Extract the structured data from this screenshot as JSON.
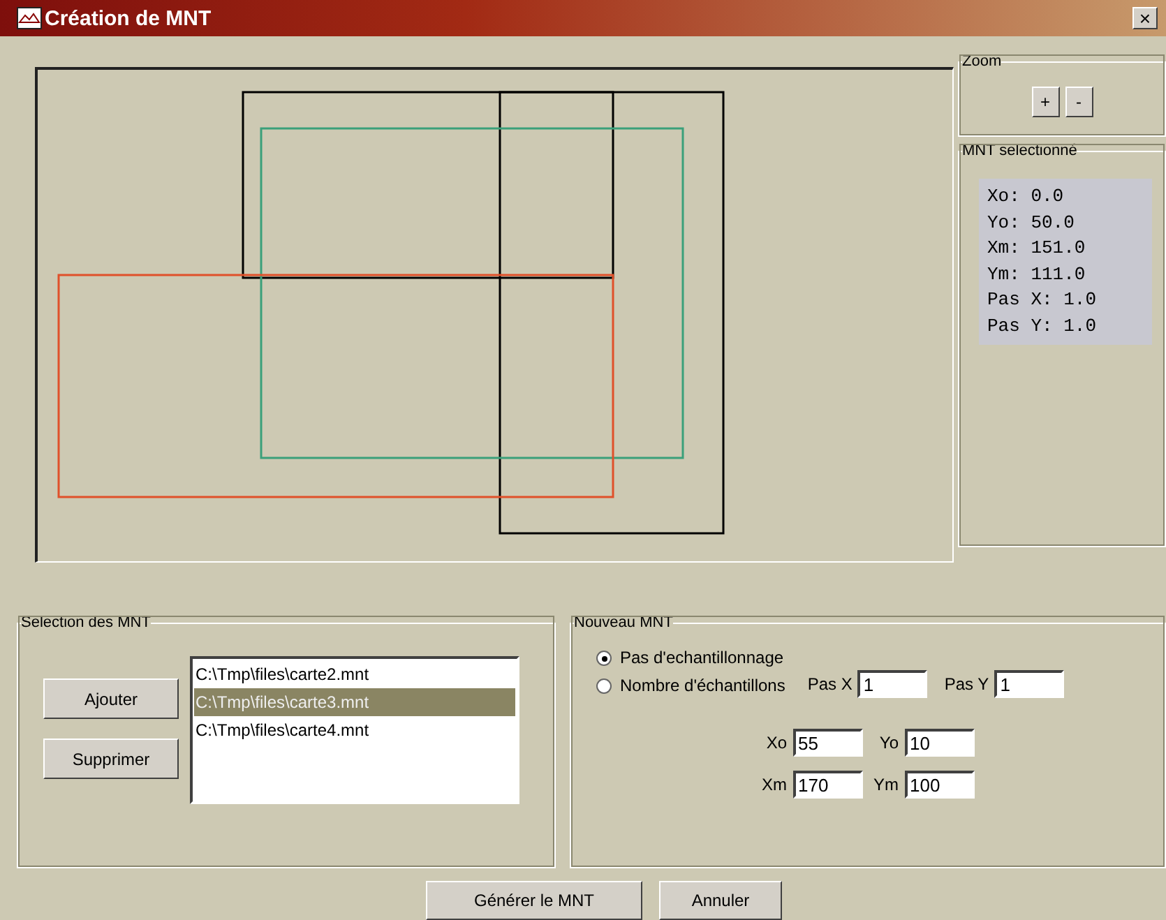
{
  "window": {
    "title": "Création de MNT",
    "close": "×"
  },
  "zoom": {
    "title": "Zoom",
    "buttons": [
      "+",
      "-"
    ]
  },
  "selected_mnt": {
    "title": "MNT selectionné",
    "lines": [
      "Xo: 0.0",
      "Yo: 50.0",
      "Xm: 151.0",
      "Ym: 111.0",
      "Pas X: 1.0",
      "Pas Y: 1.0"
    ]
  },
  "selection": {
    "title": "Selection des MNT",
    "buttons": [
      "Ajouter",
      "Supprimer"
    ],
    "files": [
      {
        "path": "C:\\Tmp\\files\\carte2.mnt",
        "selected": false
      },
      {
        "path": "C:\\Tmp\\files\\carte3.mnt",
        "selected": true
      },
      {
        "path": "C:\\Tmp\\files\\carte4.mnt",
        "selected": false
      }
    ]
  },
  "new_mnt": {
    "title": "Nouveau MNT",
    "modes": [
      {
        "label": "Pas d'echantillonnage",
        "selected": true
      },
      {
        "label": "Nombre d'échantillons",
        "selected": false
      }
    ],
    "steps": [
      {
        "label": "Pas X",
        "value": "1"
      },
      {
        "label": "Pas Y",
        "value": "1"
      }
    ],
    "bounds": [
      {
        "label": "Xo",
        "value": "55"
      },
      {
        "label": "Yo",
        "value": "10"
      },
      {
        "label": "Xm",
        "value": "170"
      },
      {
        "label": "Ym",
        "value": "100"
      }
    ]
  },
  "buttons": [
    "Générer le MNT",
    "Annuler"
  ]
}
